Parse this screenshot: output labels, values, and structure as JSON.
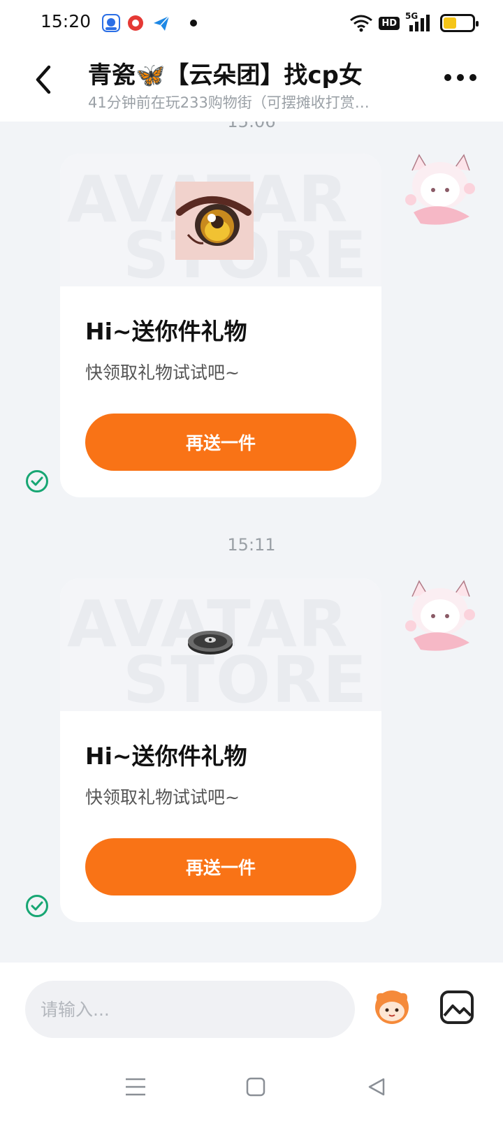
{
  "status_bar": {
    "time": "15:20",
    "hd": "HD",
    "network": "5G",
    "icons": [
      "baidu-app-icon",
      "red-record-app-icon",
      "paper-plane-app-icon",
      "notification-dot",
      "wifi-icon",
      "hd-icon",
      "signal-5g-icon",
      "battery-icon"
    ],
    "battery_color": "#f5c518"
  },
  "header": {
    "title": "青瓷🦋【云朵团】找cp女",
    "subtitle": "41分钟前在玩233购物街（可摆摊收打赏…",
    "back_icon": "chevron-left-icon",
    "more_icon": "more-dots-icon"
  },
  "messages": [
    {
      "timestamp": "15:06",
      "banner_watermark": [
        "AVATAR",
        "STORE"
      ],
      "item_icon": "anime-eye-item-icon",
      "title": "Hi~送你件礼物",
      "desc": "快领取礼物试试吧~",
      "button": "再送一件",
      "status_icon": "sent-check-icon"
    },
    {
      "timestamp": "15:11",
      "banner_watermark": [
        "AVATAR",
        "STORE"
      ],
      "item_icon": "disc-item-icon",
      "title": "Hi~送你件礼物",
      "desc": "快领取礼物试试吧~",
      "button": "再送一件",
      "status_icon": "sent-check-icon"
    }
  ],
  "input": {
    "placeholder": "请输入...",
    "emoji_icon": "emoji-avatar-icon",
    "image_icon": "image-icon"
  },
  "nav": {
    "icons": [
      "menu-icon",
      "home-icon",
      "back-icon"
    ]
  },
  "colors": {
    "accent": "#f97316",
    "check": "#17a673",
    "background": "#f2f4f7"
  }
}
